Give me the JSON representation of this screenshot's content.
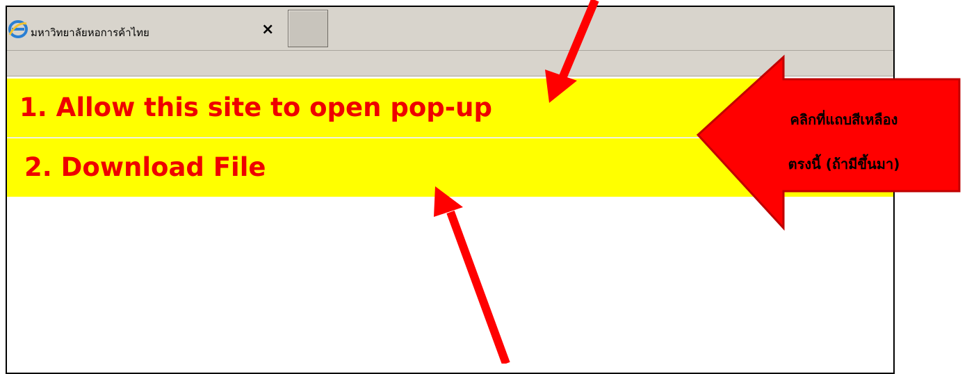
{
  "browser": {
    "tab_title": "มหาวิทยาลัยหอการค้าไทย",
    "tab_close": "×",
    "icon": "internet-explorer-icon"
  },
  "infobars": {
    "allow_popup": "1. Allow this site to open pop-up",
    "download_file": "2. Download File"
  },
  "callout": {
    "line1": "คลิกที่แถบสีเหลือง",
    "line2": "ตรงนี้ (ถ้ามีขึ้นมา)",
    "color": "#ff0000"
  },
  "colors": {
    "infobar": "#ffff00",
    "infobar_text": "#ee0000",
    "arrow": "#ff0000"
  }
}
